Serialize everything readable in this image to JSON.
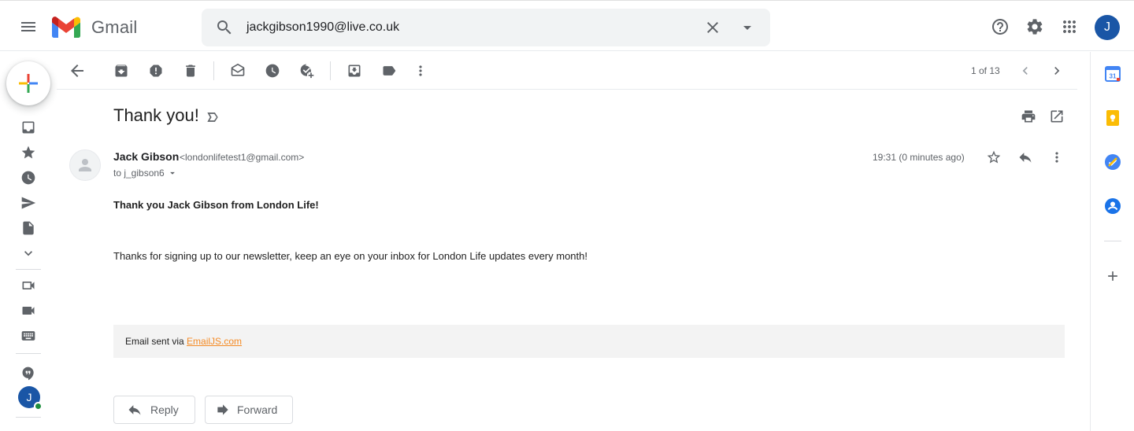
{
  "app": {
    "name": "Gmail"
  },
  "search": {
    "query": "jackgibson1990@live.co.uk"
  },
  "account": {
    "initial": "J",
    "avatar_color": "#1a56a6"
  },
  "toolbar": {
    "pager": "1 of 13"
  },
  "message": {
    "subject": "Thank you!",
    "sender_name": "Jack Gibson",
    "sender_email": "<londonlifetest1@gmail.com>",
    "to": "to j_gibson6",
    "timestamp": "19:31 (0 minutes ago)",
    "body_heading": "Thank you Jack Gibson from London Life!",
    "body_text": "Thanks for signing up to our newsletter, keep an eye on your inbox for London Life updates every month!",
    "footer_prefix": "Email sent via ",
    "footer_link": "EmailJS.com",
    "footer_link_color": "#f48a24"
  },
  "actions": {
    "reply": "Reply",
    "forward": "Forward"
  },
  "icons": {
    "header": [
      "menu-icon",
      "gmail-logo",
      "search-icon",
      "clear-search-icon",
      "search-options-icon",
      "help-icon",
      "settings-icon",
      "apps-icon"
    ],
    "rail": [
      "compose-icon",
      "inbox-icon",
      "starred-icon",
      "snoozed-icon",
      "sent-icon",
      "drafts-icon",
      "more-icon",
      "new-meeting-icon",
      "join-meeting-icon",
      "keyboard-icon",
      "hangouts-icon"
    ],
    "toolbar": [
      "back-icon",
      "archive-icon",
      "report-spam-icon",
      "delete-icon",
      "mark-unread-icon",
      "snooze-icon",
      "add-to-tasks-icon",
      "move-to-icon",
      "label-icon",
      "more-vert-icon",
      "newer-icon",
      "older-icon"
    ],
    "side_panel": [
      "calendar-icon",
      "keep-icon",
      "tasks-icon",
      "contacts-icon",
      "add-addon-icon"
    ]
  }
}
